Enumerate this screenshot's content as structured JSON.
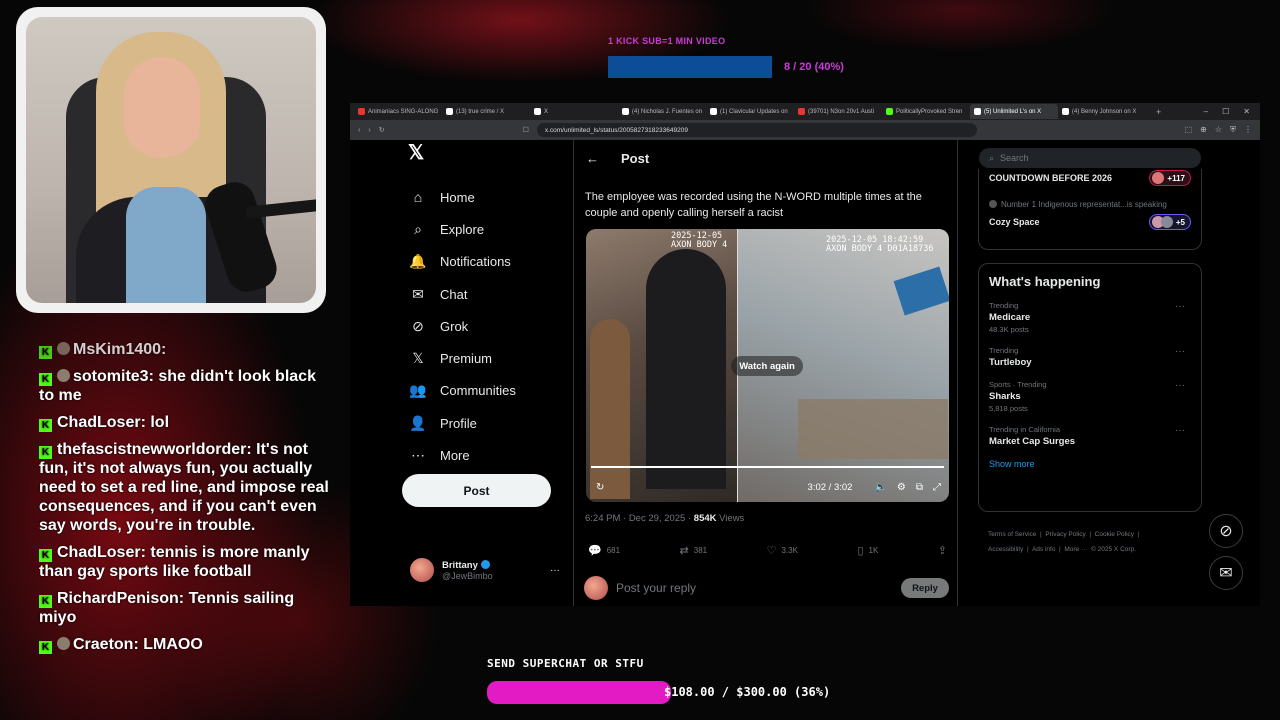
{
  "top_goal": {
    "label": "1 KICK SUB=1 MIN VIDEO",
    "progress_text": "8 / 20 (40%)",
    "progress": 0.4
  },
  "chat": [
    {
      "user": "MsKim1400:",
      "text": "",
      "partial": true
    },
    {
      "user": "sotomite3:",
      "text": "she didn't look black to me"
    },
    {
      "user": "ChadLoser:",
      "text": "lol"
    },
    {
      "user": "thefascistnewworldorder:",
      "text": "It's not fun, it's not always fun, you actually need to set a red line, and impose real consequences, and if you can't even say words, you're in trouble."
    },
    {
      "user": "ChadLoser:",
      "text": "tennis is more manly than gay sports like football"
    },
    {
      "user": "RichardPenison:",
      "text": "Tennis sailing miyo"
    },
    {
      "user": "Craeton:",
      "text": "LMAOO"
    }
  ],
  "browser": {
    "tabs": [
      {
        "title": "Animaniacs SING-ALONG",
        "color": "#e33"
      },
      {
        "title": "(13) true crime / X",
        "color": "#fff"
      },
      {
        "title": "X",
        "color": "#fff"
      },
      {
        "title": "(4) Nicholas J. Fuentes on",
        "color": "#fff"
      },
      {
        "title": "(1) Clavicular Updates on",
        "color": "#fff"
      },
      {
        "title": "(39701) N3on 20v1 Austi",
        "color": "#e33"
      },
      {
        "title": "PoliticallyProvoked Stren",
        "color": "#53fc18"
      },
      {
        "title": "(5) Unlimited L's on X",
        "color": "#fff",
        "active": true
      },
      {
        "title": "(4) Benny Johnson on X",
        "color": "#fff"
      }
    ],
    "url": "x.com/unlimited_ls/status/2005827318233649209"
  },
  "x": {
    "nav": [
      {
        "icon": "⌂",
        "label": "Home",
        "name": "home"
      },
      {
        "icon": "⌕",
        "label": "Explore",
        "name": "explore"
      },
      {
        "icon": "🔔",
        "label": "Notifications",
        "name": "notifications"
      },
      {
        "icon": "✉",
        "label": "Chat",
        "name": "chat"
      },
      {
        "icon": "⊘",
        "label": "Grok",
        "name": "grok"
      },
      {
        "icon": "𝕏",
        "label": "Premium",
        "name": "premium"
      },
      {
        "icon": "👥",
        "label": "Communities",
        "name": "communities"
      },
      {
        "icon": "👤",
        "label": "Profile",
        "name": "profile"
      },
      {
        "icon": "⋯",
        "label": "More",
        "name": "more"
      }
    ],
    "post_button": "Post",
    "account": {
      "name": "Brittany",
      "handle": "@JewBimbo"
    },
    "header_title": "Post",
    "post_text": "The employee was recorded using the N-WORD multiple times at the couple and openly calling herself a racist",
    "video": {
      "left_timestamp": "2025-12-05\nAXON BODY 4",
      "right_timestamp": "2025-12-05 18:42:59\nAXON BODY 4 D01A18736",
      "overlay": "Watch again",
      "time": "3:02 / 3:02"
    },
    "meta": {
      "time": "6:24 PM · Dec 29, 2025 · ",
      "views": "854K",
      "views_label": " Views"
    },
    "actions": {
      "replies": "681",
      "reposts": "381",
      "likes": "3.3K",
      "bookmarks": "1K"
    },
    "reply_placeholder": "Post your reply",
    "reply_button": "Reply",
    "search_placeholder": "Search",
    "spaces": [
      {
        "title": "COUNTDOWN BEFORE 2026",
        "badge": "+117"
      },
      {
        "speaker": "Number 1 Indigenous representat...",
        "status": " is speaking"
      },
      {
        "title": "Cozy Space",
        "badge": "+5"
      }
    ],
    "whats_happening": {
      "title": "What's happening",
      "trends": [
        {
          "category": "Trending",
          "name": "Medicare",
          "count": "48.3K posts"
        },
        {
          "category": "Trending",
          "name": "Turtleboy",
          "count": ""
        },
        {
          "category": "Sports · Trending",
          "name": "Sharks",
          "count": "5,818 posts"
        },
        {
          "category": "Trending in California",
          "name": "Market Cap Surges",
          "count": ""
        }
      ],
      "show_more": "Show more"
    },
    "footer": "Terms of Service  |  Privacy Policy  |  Cookie Policy  |\nAccessibility  |  Ads info  |  More ···  © 2025 X Corp."
  },
  "superchat": {
    "label": "SEND SUPERCHAT OR STFU",
    "progress_text": "$108.00 / $300.00 (36%)",
    "progress": 0.36
  }
}
